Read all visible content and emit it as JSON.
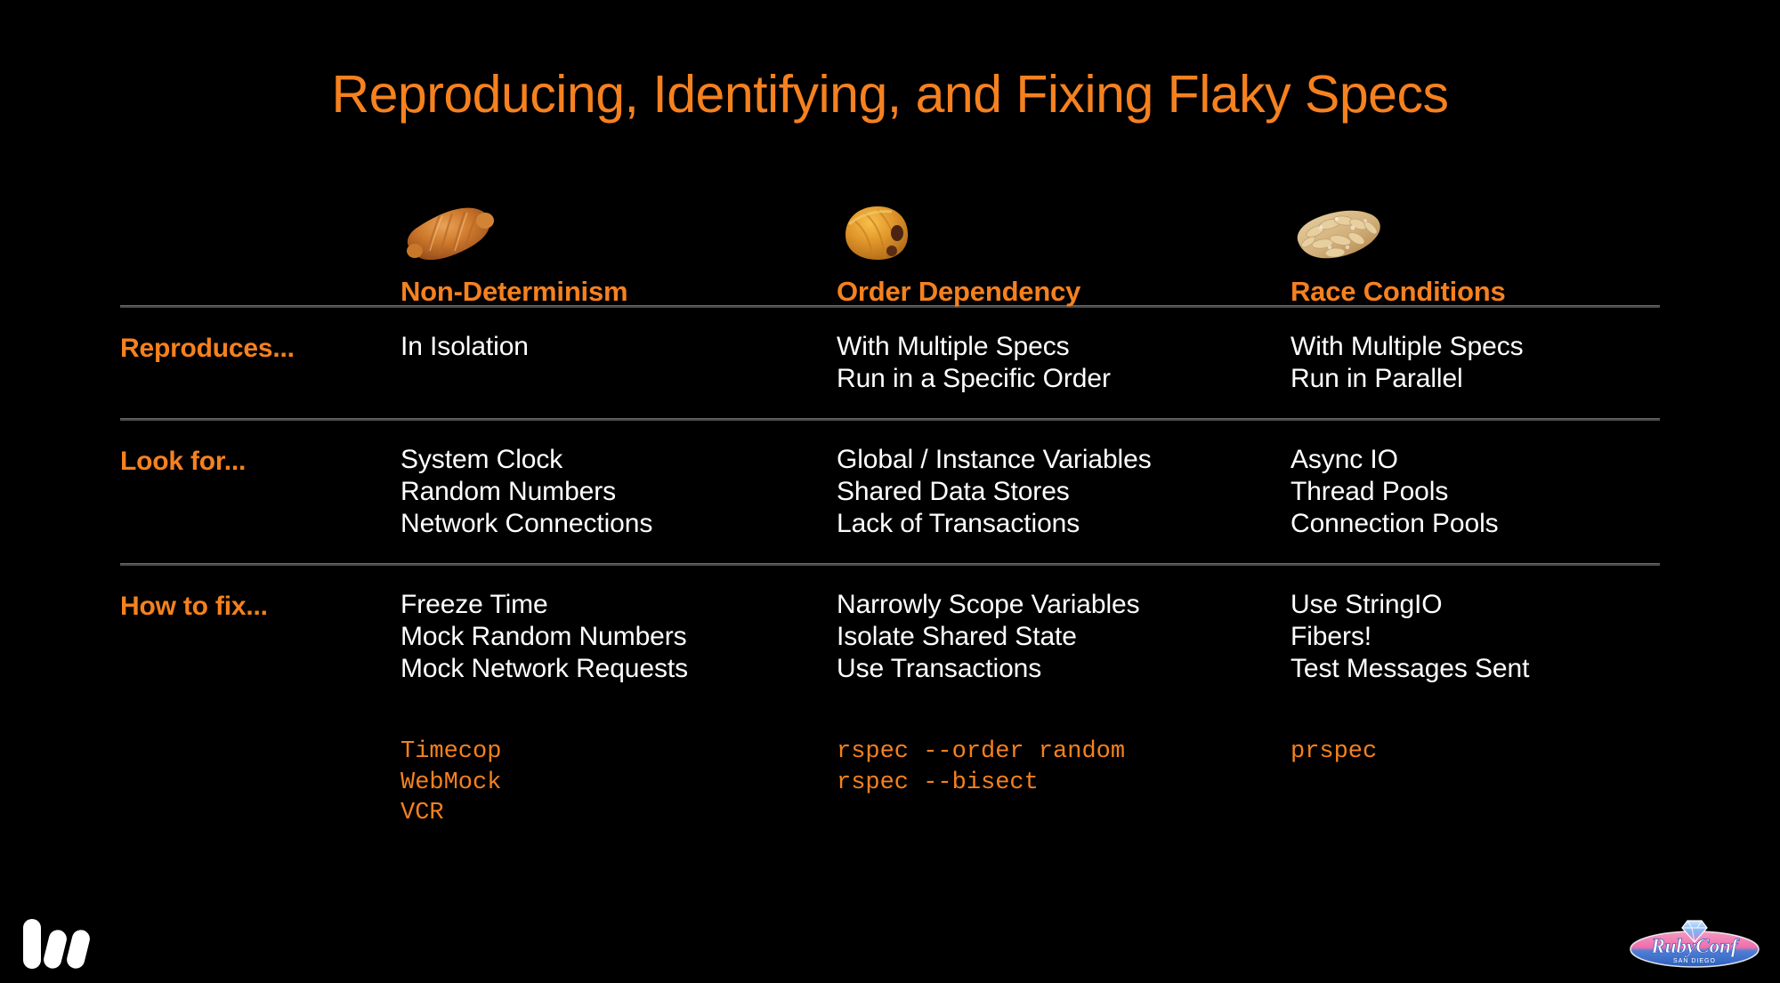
{
  "slide": {
    "title": "Reproducing, Identifying, and Fixing Flaky Specs",
    "background_color": "#000000",
    "accent_color": "#F5811F",
    "text_color": "#FFFFFF",
    "divider_color": "#4A4A4A"
  },
  "columns": [
    {
      "id": "non-determinism",
      "label": "Non-Determinism",
      "icon": "croissant-icon"
    },
    {
      "id": "order-dependency",
      "label": "Order Dependency",
      "icon": "pain-au-chocolat-icon"
    },
    {
      "id": "race-conditions",
      "label": "Race Conditions",
      "icon": "almond-croissant-icon"
    }
  ],
  "rows": [
    {
      "id": "reproduces",
      "label": "Reproduces...",
      "cells": [
        [
          "In Isolation"
        ],
        [
          "With Multiple Specs",
          "Run in a Specific Order"
        ],
        [
          "With Multiple Specs",
          "Run in Parallel"
        ]
      ]
    },
    {
      "id": "look-for",
      "label": "Look for...",
      "cells": [
        [
          "System Clock",
          "Random Numbers",
          "Network Connections"
        ],
        [
          "Global / Instance Variables",
          "Shared Data Stores",
          "Lack of Transactions"
        ],
        [
          "Async IO",
          "Thread Pools",
          "Connection Pools"
        ]
      ]
    },
    {
      "id": "how-to-fix",
      "label": "How to fix...",
      "cells": [
        [
          "Freeze Time",
          "Mock Random Numbers",
          "Mock Network Requests"
        ],
        [
          "Narrowly Scope Variables",
          "Isolate Shared State",
          "Use Transactions"
        ],
        [
          "Use StringIO",
          "Fibers!",
          "Test Messages Sent"
        ]
      ]
    }
  ],
  "tools": [
    [
      "Timecop",
      "WebMock",
      "VCR"
    ],
    [
      "rspec --order random",
      "rspec --bisect"
    ],
    [
      "prspec"
    ]
  ],
  "logos": {
    "left": {
      "name": "m-logo",
      "alt": "M"
    },
    "right": {
      "name": "rubyconf-logo",
      "title": "RubyConf",
      "subtitle": "SAN DIEGO"
    }
  }
}
